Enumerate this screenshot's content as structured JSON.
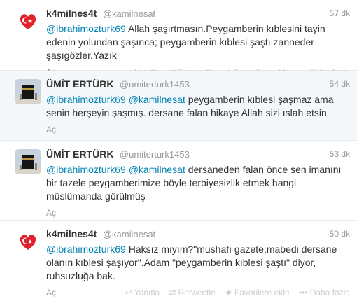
{
  "tweets": [
    {
      "avatar": "heart-logo",
      "fullname": "k4milnes4t",
      "username": "@kamilnesat",
      "time": "57 dk",
      "mentions": [
        "@ibrahimozturk69"
      ],
      "text": "Allah şaşırtmasın.Peygamberin kıblesini tayin edenin yolundan şaşınca; peygamberin kıblesi şaştı zanneder şaşıgözler.Yazık",
      "expand": "Aç"
    },
    {
      "avatar": "kaaba",
      "fullname": "ÜMİT ERTÜRK",
      "username": "@umiterturk1453",
      "time": "54 dk",
      "mentions": [
        "@ibrahimozturk69",
        "@kamilnesat"
      ],
      "text": "peygamberin kıblesi şaşmaz ama senin herşeyin şaşmış. dersane falan hikaye Allah sizi ıslah etsin",
      "expand": "Aç"
    },
    {
      "avatar": "kaaba",
      "fullname": "ÜMİT ERTÜRK",
      "username": "@umiterturk1453",
      "time": "53 dk",
      "mentions": [
        "@ibrahimozturk69",
        "@kamilnesat"
      ],
      "text": "dersaneden falan önce sen imanını bir tazele peygamberimize böyle terbiyesizlik etmek hangi müslümanda görülmüş",
      "expand": "Aç"
    },
    {
      "avatar": "heart-logo",
      "fullname": "k4milnes4t",
      "username": "@kamilnesat",
      "time": "50 dk",
      "mentions": [
        "@ibrahimozturk69"
      ],
      "text": "Haksız mıyım?\"mushafı gazete,mabedi dersane olanın kıblesi şaşıyor\".Adam \"peygamberin kıblesi şaştı\" diyor, ruhsuzluğa bak.",
      "expand": "Aç"
    }
  ],
  "actions": {
    "reply": "Yanıtla",
    "retweet": "Retweetle",
    "favorite": "Favorilere ekle",
    "more": "Daha fazla"
  },
  "icons": {
    "reply": "reply-arrow-icon",
    "retweet": "retweet-icon",
    "favorite": "star-icon",
    "more": "dots-icon"
  },
  "colors": {
    "mention": "#0084b4",
    "muted": "#999999",
    "heart": "#e0222a",
    "alt_row": "#f5f8fa"
  }
}
